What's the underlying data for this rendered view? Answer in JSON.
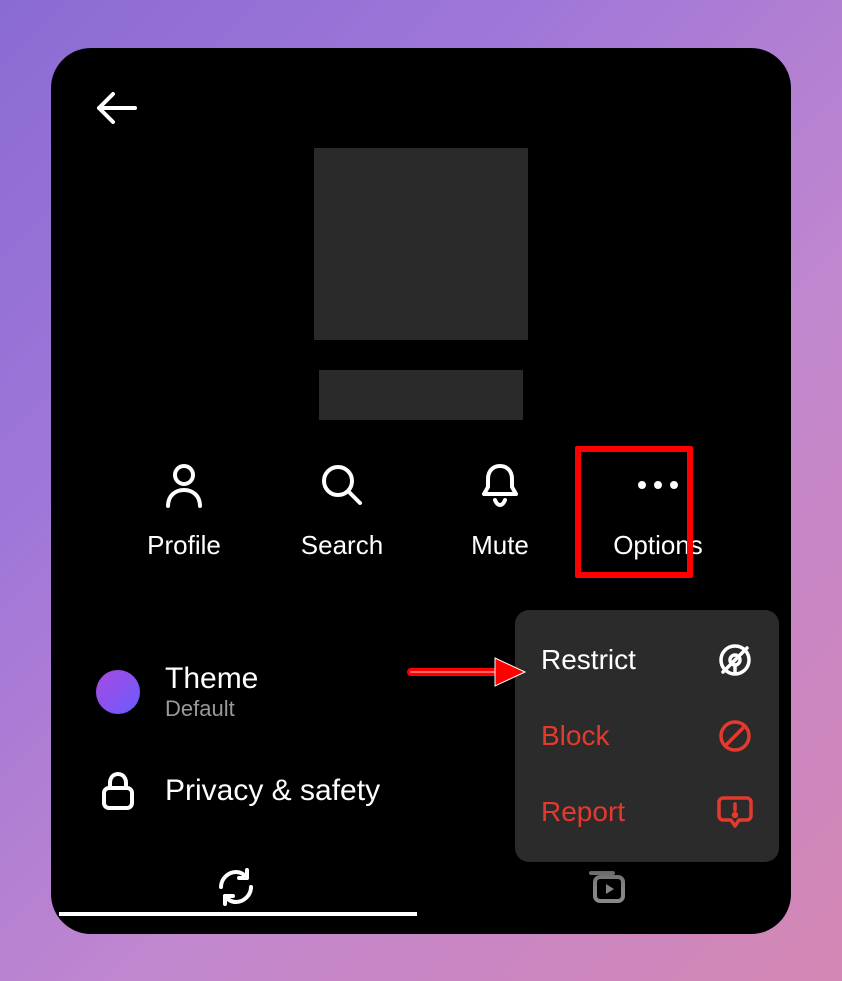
{
  "actions": {
    "profile": "Profile",
    "search": "Search",
    "mute": "Mute",
    "options": "Options"
  },
  "settings": {
    "theme": {
      "title": "Theme",
      "sub": "Default"
    },
    "privacy": {
      "title": "Privacy & safety"
    }
  },
  "popup": {
    "restrict": "Restrict",
    "block": "Block",
    "report": "Report"
  }
}
